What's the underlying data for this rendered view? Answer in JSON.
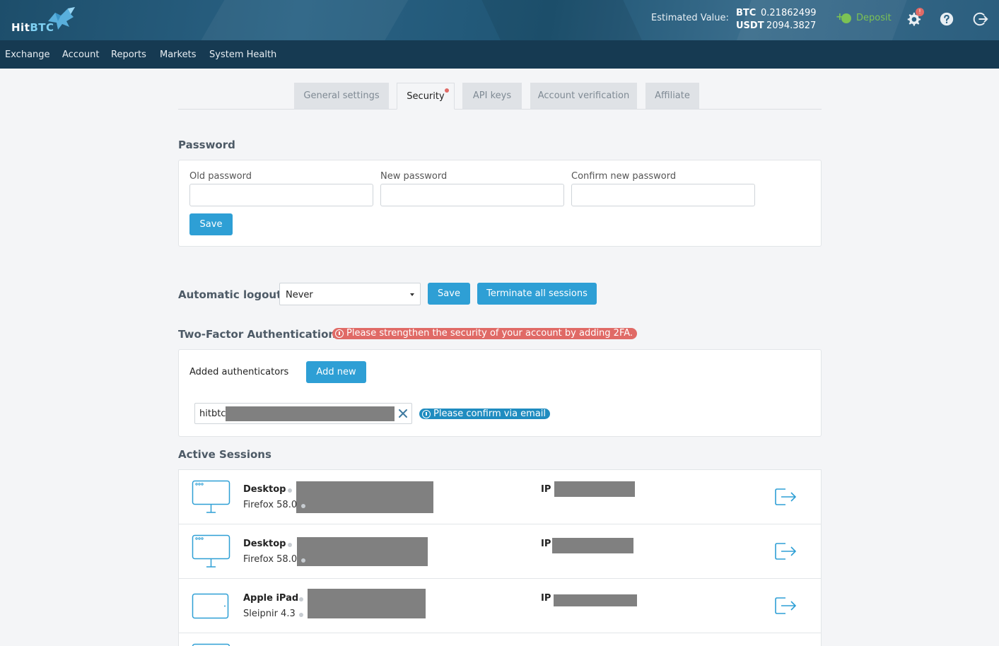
{
  "header": {
    "logo_hit": "Hit",
    "logo_btc": "BTC",
    "estimated_label": "Estimated Value:",
    "balances": [
      {
        "currency": "BTC",
        "amount": "0.21862499"
      },
      {
        "currency": "USDT",
        "amount": "2094.3827"
      }
    ],
    "deposit_label": "Deposit",
    "notification_count": "!",
    "icons": [
      "settings-icon",
      "help-icon",
      "logout-icon"
    ]
  },
  "nav": {
    "items": [
      "Exchange",
      "Account",
      "Reports",
      "Markets",
      "System Health"
    ]
  },
  "tabs": {
    "items": [
      "General settings",
      "Security",
      "API keys",
      "Account verification",
      "Affiliate"
    ],
    "active": "Security"
  },
  "password": {
    "title": "Password",
    "old_label": "Old password",
    "new_label": "New password",
    "confirm_label": "Confirm new password",
    "save_label": "Save"
  },
  "logout": {
    "title": "Automatic logout",
    "selected": "Never",
    "save_label": "Save",
    "terminate_label": "Terminate all sessions"
  },
  "twofa": {
    "title": "Two-Factor Authentication",
    "warning": "Please strengthen the security of your account by adding 2FA.",
    "added_label": "Added authenticators",
    "add_new_label": "Add new",
    "authenticator_value": "hitbtc-",
    "confirm_notice": "Please confirm via email"
  },
  "sessions": {
    "title": "Active Sessions",
    "ip_label": "IP",
    "rows": [
      {
        "device": "Desktop",
        "browser": "Firefox 58.0",
        "icon": "desktop-icon"
      },
      {
        "device": "Desktop",
        "browser": "Firefox 58.0",
        "icon": "desktop-icon"
      },
      {
        "device": "Apple iPad",
        "browser": "Sleipnir 4.3",
        "icon": "tablet-icon"
      }
    ]
  },
  "colors": {
    "accent": "#2e9fd5",
    "header_bg": "#1f5574",
    "nav_bg": "#163a52",
    "warning": "#e06a66",
    "deposit": "#7cc254"
  }
}
